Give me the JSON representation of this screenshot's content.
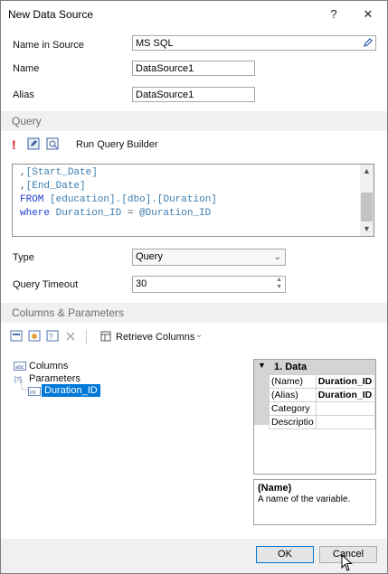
{
  "window": {
    "title": "New Data Source",
    "help_label": "?",
    "close_label": "✕"
  },
  "source": {
    "name_in_source_label": "Name in Source",
    "name_in_source_value": "MS SQL",
    "name_label": "Name",
    "name_value": "DataSource1",
    "alias_label": "Alias",
    "alias_value": "DataSource1"
  },
  "query_section": {
    "title": "Query",
    "run_query_builder_label": "Run Query Builder",
    "code_lines": [
      [
        {
          "t": ",",
          "c": "pun"
        },
        {
          "t": "[",
          "c": "br"
        },
        {
          "t": "Start_Date",
          "c": "id"
        },
        {
          "t": "]",
          "c": "br"
        }
      ],
      [
        {
          "t": ",",
          "c": "pun"
        },
        {
          "t": "[",
          "c": "br"
        },
        {
          "t": "End_Date",
          "c": "id"
        },
        {
          "t": "]",
          "c": "br"
        }
      ],
      [
        {
          "t": "FROM ",
          "c": "kw"
        },
        {
          "t": "[",
          "c": "br"
        },
        {
          "t": "education",
          "c": "id"
        },
        {
          "t": "].[",
          "c": "br"
        },
        {
          "t": "dbo",
          "c": "id"
        },
        {
          "t": "].[",
          "c": "br"
        },
        {
          "t": "Duration",
          "c": "id"
        },
        {
          "t": "]",
          "c": "br"
        }
      ],
      [
        {
          "t": "where ",
          "c": "kw"
        },
        {
          "t": "Duration_ID ",
          "c": "id"
        },
        {
          "t": "= ",
          "c": "pun"
        },
        {
          "t": "@Duration_ID",
          "c": "id"
        }
      ]
    ]
  },
  "type_field": {
    "label": "Type",
    "value": "Query"
  },
  "timeout_field": {
    "label": "Query Timeout",
    "value": "30"
  },
  "columns_section": {
    "title": "Columns & Parameters",
    "retrieve_columns_label": "Retrieve Columns",
    "tree": {
      "columns_label": "Columns",
      "parameters_label": "Parameters",
      "parameter_item": "Duration_ID"
    }
  },
  "property_grid": {
    "category_label": "1. Data",
    "rows": [
      {
        "name": "(Name)",
        "value": "Duration_ID"
      },
      {
        "name": "(Alias)",
        "value": "Duration_ID"
      },
      {
        "name": "Category",
        "value": ""
      },
      {
        "name": "Descriptio",
        "value": ""
      }
    ],
    "help_title": "(Name)",
    "help_text": "A name of the variable."
  },
  "footer": {
    "ok_label": "OK",
    "cancel_label": "Cancel"
  },
  "colors": {
    "section_bg": "#f0f0f0",
    "selection": "#0078d7",
    "keyword": "#1f3fd0",
    "identifier": "#3a7db0"
  }
}
